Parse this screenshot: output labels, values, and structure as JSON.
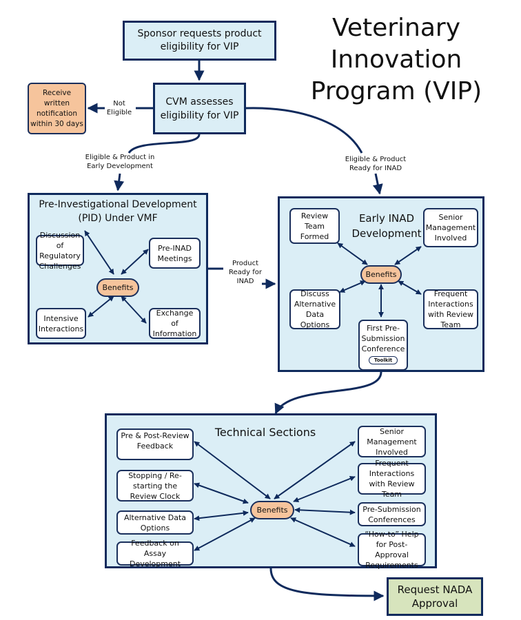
{
  "title": {
    "line1": "Veterinary",
    "line2": "Innovation",
    "line3": "Program (VIP)"
  },
  "sponsor_box": "Sponsor requests product eligibility for VIP",
  "cvm_box": "CVM assesses eligibility for VIP",
  "notification_box": "Receive written notification within 30 days",
  "labels": {
    "not_eligible": "Not Eligible",
    "eligible_early": "Eligible & Product in Early Development",
    "eligible_inad": "Eligible & Product Ready for INAD",
    "product_ready": "Product Ready for INAD"
  },
  "pid": {
    "title": "Pre-Investigational Development (PID) Under VMF",
    "center": "Benefits",
    "items": [
      "Discussion of Regulatory Challenges",
      "Pre-INAD Meetings",
      "Intensive Interactions",
      "Exchange of Information"
    ]
  },
  "inad": {
    "title": "Early INAD Development",
    "center": "Benefits",
    "items": [
      "Review Team Formed",
      "Senior Management Involved",
      "Discuss Alternative Data Options",
      "Frequent Interactions with Review Team",
      "First Pre-Submission Conference"
    ],
    "toolkit": "Toolkit"
  },
  "tech": {
    "title": "Technical Sections",
    "center": "Benefits",
    "left": [
      "Pre & Post-Review Feedback",
      "Stopping / Re-starting the Review Clock",
      "Alternative Data Options",
      "Feedback on Assay Development"
    ],
    "right": [
      "Senior Management Involved",
      "Frequent Interactions with Review Team",
      "Pre-Submission Conferences",
      "“How-to” Help for Post-Approval Requirements"
    ]
  },
  "nada_box": "Request NADA Approval",
  "colors": {
    "navy": "#0f2a5c",
    "light_blue": "#dbeef6",
    "orange": "#f6c49c",
    "green": "#d7e4bd"
  }
}
